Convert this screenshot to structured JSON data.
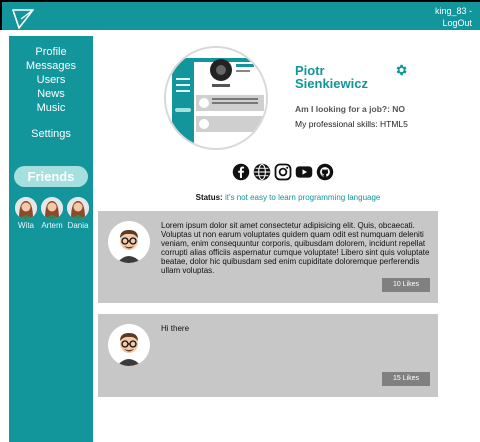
{
  "header": {
    "logo_icon": "triangle-logo-icon",
    "username": "king_83 -",
    "logout_label": "LogOut"
  },
  "sidebar": {
    "items": [
      {
        "label": "Profile"
      },
      {
        "label": "Messages"
      },
      {
        "label": "Users"
      },
      {
        "label": "News"
      },
      {
        "label": "Music"
      },
      {
        "label": "Settings"
      }
    ],
    "friends_label": "Friends",
    "friends": [
      {
        "name": "Wita"
      },
      {
        "name": "Artem"
      },
      {
        "name": "Dania"
      }
    ]
  },
  "profile": {
    "name": "Piotr Sienkiewicz",
    "looking_for_job": "Am I looking for a job?: NO",
    "skills": "My professional skills: HTML5"
  },
  "socials": [
    "facebook-icon",
    "globe-icon",
    "instagram-icon",
    "youtube-icon",
    "github-icon"
  ],
  "status": {
    "label": "Status:",
    "text": "it's not easy to learn programming language"
  },
  "posts": [
    {
      "text": "Lorem ipsum dolor sit amet consectetur adipisicing elit. Quis, obcaecati. Voluptas ut non earum voluptates quidem quam odit est numquam deleniti veniam, enim consequuntur corporis, quibusdam dolorem, incidunt repellat corrupti alias officiis aspernatur cumque voluptate! Libero sint quis voluptate beatae, dolor hic quibusdam sed enim cupiditate doloremque perferendis ullam voluptas.",
      "likes": "10 Likes"
    },
    {
      "text": "Hi there",
      "likes": "15 Likes"
    }
  ],
  "colors": {
    "accent": "#12959b",
    "friends_pill": "#a5e0df",
    "post_bg": "#c7c7c7",
    "likes_bg": "#808080"
  }
}
